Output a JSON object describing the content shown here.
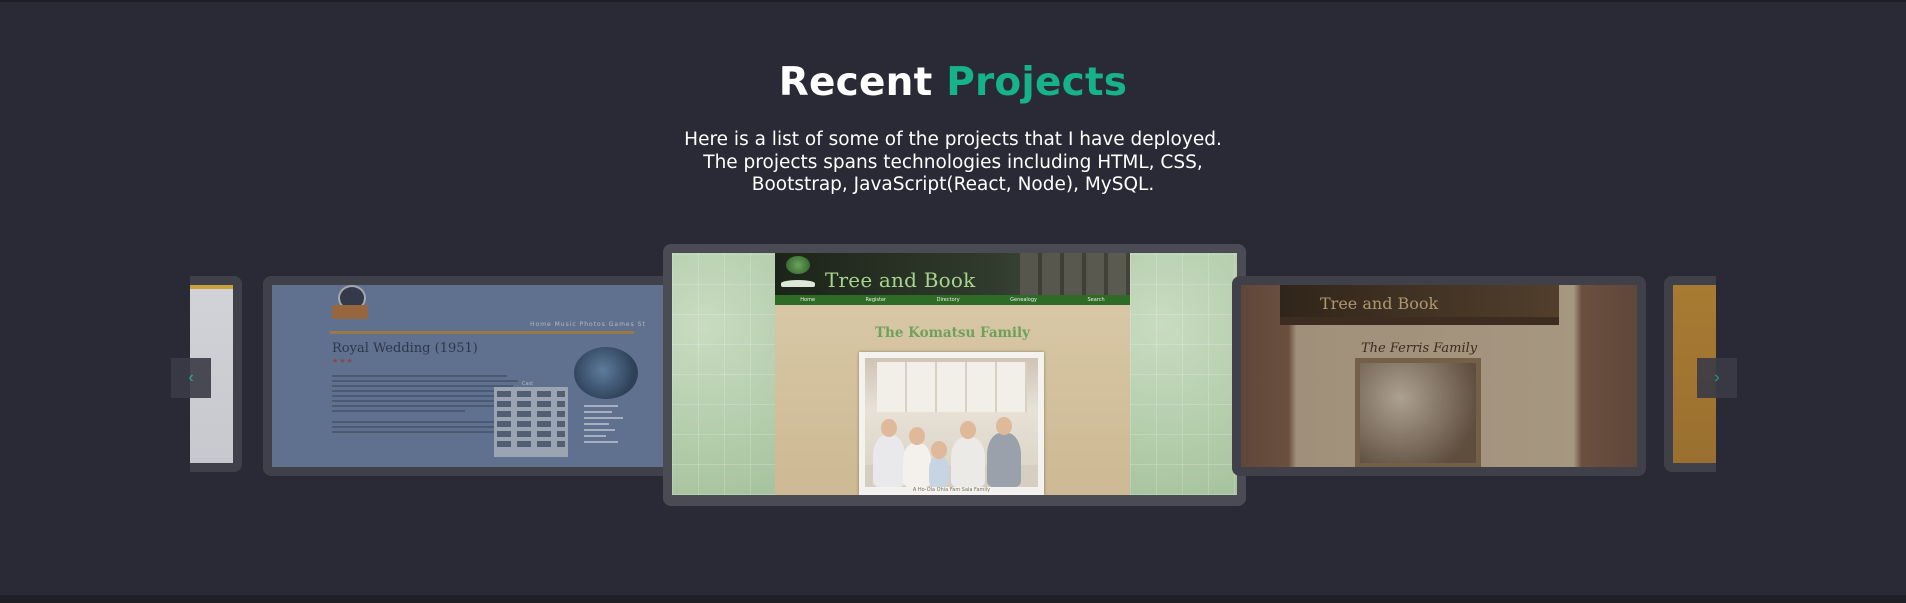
{
  "section": {
    "title_main": "Recent",
    "title_accent": "Projects",
    "description": "Here is a list of some of the projects that I have deployed. The projects spans technologies including HTML, CSS, Bootstrap, JavaScript(React, Node), MySQL."
  },
  "colors": {
    "background": "#2a2a36",
    "accent": "#16b38b",
    "card_frame": "#3f4049"
  },
  "carousel": {
    "prev_icon": "chevron-left-icon",
    "next_icon": "chevron-right-icon",
    "prev_glyph": "‹",
    "next_glyph": "›",
    "slides": [
      {
        "title": "Royal Wedding (1951)",
        "nav": "Home  Music  Photos  Games  St",
        "cast_label": "Cast"
      },
      {
        "brand": "Tree and Book",
        "nav": [
          "Home",
          "Register",
          "Directory",
          "Genealogy",
          "Search"
        ],
        "family_title": "The Komatsu Family",
        "caption": "A Ho-Ola Ohia Fam Sala Family"
      },
      {
        "brand": "Tree and Book",
        "family_title": "The Ferris Family"
      }
    ]
  }
}
